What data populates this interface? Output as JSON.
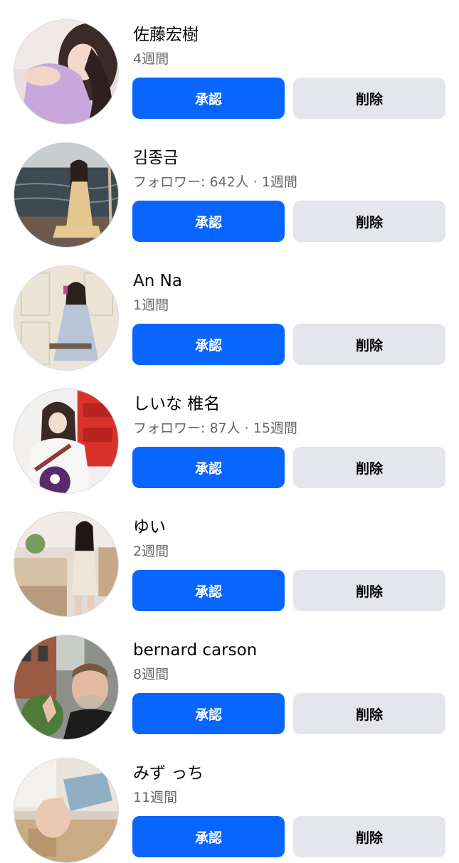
{
  "requests": [
    {
      "name": "佐藤宏樹",
      "meta": "4週間",
      "confirm_label": "承認",
      "delete_label": "削除",
      "avatar": "woman-lavender-top-photo"
    },
    {
      "name": "김종금",
      "meta": "フォロワー: 642人 · 1週間",
      "confirm_label": "承認",
      "delete_label": "削除",
      "avatar": "woman-waterside-photo"
    },
    {
      "name": "An Na",
      "meta": "1週間",
      "confirm_label": "承認",
      "delete_label": "削除",
      "avatar": "woman-mirror-selfie-photo"
    },
    {
      "name": "しいな 椎名",
      "meta": "フォロワー: 87人 · 15週間",
      "confirm_label": "承認",
      "delete_label": "削除",
      "avatar": "woman-white-sweater-photo"
    },
    {
      "name": "ゆい",
      "meta": "2週間",
      "confirm_label": "承認",
      "delete_label": "削除",
      "avatar": "woman-kitchen-photo"
    },
    {
      "name": "bernard carson",
      "meta": "8週間",
      "confirm_label": "承認",
      "delete_label": "削除",
      "avatar": "man-street-photo"
    },
    {
      "name": "みず っち",
      "meta": "11週間",
      "confirm_label": "承認",
      "delete_label": "削除",
      "avatar": "person-bathroom-photo"
    }
  ],
  "colors": {
    "primary": "#0866ff",
    "secondary": "#e4e6eb",
    "text": "#050505",
    "meta": "#65676b"
  }
}
